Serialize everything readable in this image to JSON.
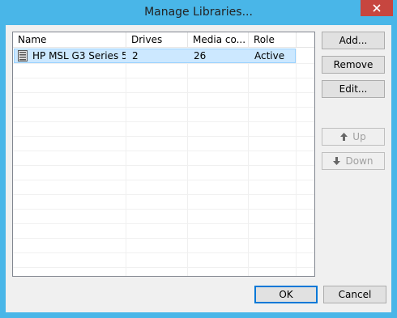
{
  "window": {
    "title": "Manage Libraries..."
  },
  "list": {
    "columns": [
      "Name",
      "Drives",
      "Media co...",
      "Role"
    ],
    "rows": [
      {
        "name": "HP MSL G3 Series 5...",
        "drives": "2",
        "media": "26",
        "role": "Active"
      }
    ]
  },
  "buttons": {
    "add": "Add...",
    "remove": "Remove",
    "edit": "Edit...",
    "up": "Up",
    "down": "Down",
    "ok": "OK",
    "cancel": "Cancel"
  },
  "colors": {
    "frame": "#49b6e8",
    "close": "#c7463f",
    "selection": "#cce8ff"
  }
}
